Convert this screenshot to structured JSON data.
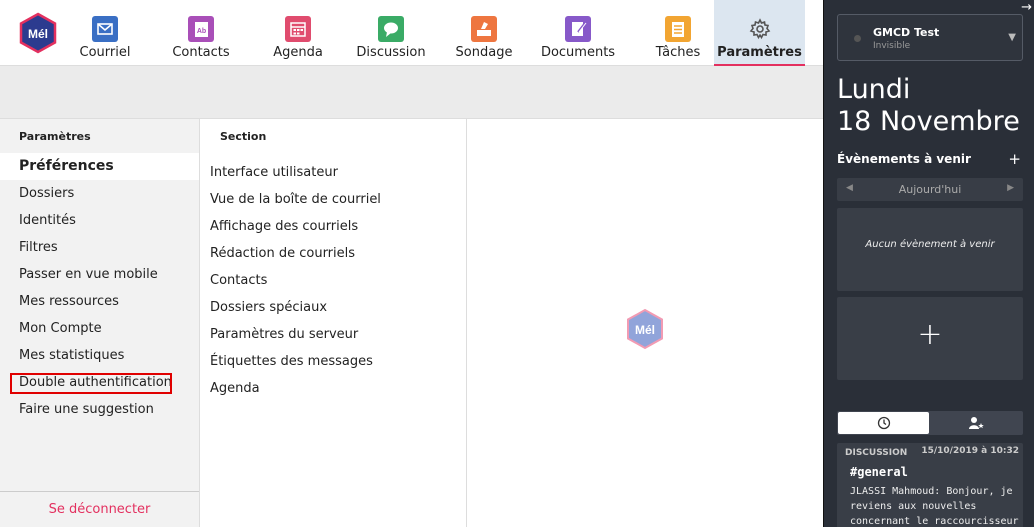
{
  "logo_text": "Mél",
  "nav": [
    {
      "label": "Courriel",
      "icon": "mail-icon",
      "color": "#3a6fc4"
    },
    {
      "label": "Contacts",
      "icon": "contacts-icon",
      "color": "#a94fb8"
    },
    {
      "label": "Agenda",
      "icon": "calendar-icon",
      "color": "#e04c6e"
    },
    {
      "label": "Discussion",
      "icon": "chat-icon",
      "color": "#3aab66"
    },
    {
      "label": "Sondage",
      "icon": "poll-icon",
      "color": "#ee7640"
    },
    {
      "label": "Documents",
      "icon": "documents-icon",
      "color": "#8759c9"
    },
    {
      "label": "Tâches",
      "icon": "tasks-icon",
      "color": "#f2a532"
    },
    {
      "label": "Paramètres",
      "icon": "gear-icon",
      "color": "#555555"
    }
  ],
  "settings": {
    "title": "Paramètres",
    "items": [
      "Préférences",
      "Dossiers",
      "Identités",
      "Filtres",
      "Passer en vue mobile",
      "Mes ressources",
      "Mon Compte",
      "Mes statistiques",
      "Double authentification",
      "Faire une suggestion"
    ],
    "logout": "Se déconnecter"
  },
  "section": {
    "title": "Section",
    "items": [
      "Interface utilisateur",
      "Vue de la boîte de courriel",
      "Affichage des courriels",
      "Rédaction de courriels",
      "Contacts",
      "Dossiers spéciaux",
      "Paramètres du serveur",
      "Étiquettes des messages",
      "Agenda"
    ]
  },
  "panel": {
    "user_name": "GMCD Test",
    "user_status": "Invisible",
    "day_name": "Lundi",
    "day_date": "18 Novembre",
    "events_title": "Évènements à venir",
    "day_nav_label": "Aujourd'hui",
    "no_event": "Aucun évènement à venir",
    "notification": {
      "category": "DISCUSSION",
      "time": "15/10/2019 à 10:32",
      "title": "#general",
      "body": "JLASSI Mahmoud: Bonjour, je reviens aux nouvelles concernant le raccourcisseur"
    }
  }
}
